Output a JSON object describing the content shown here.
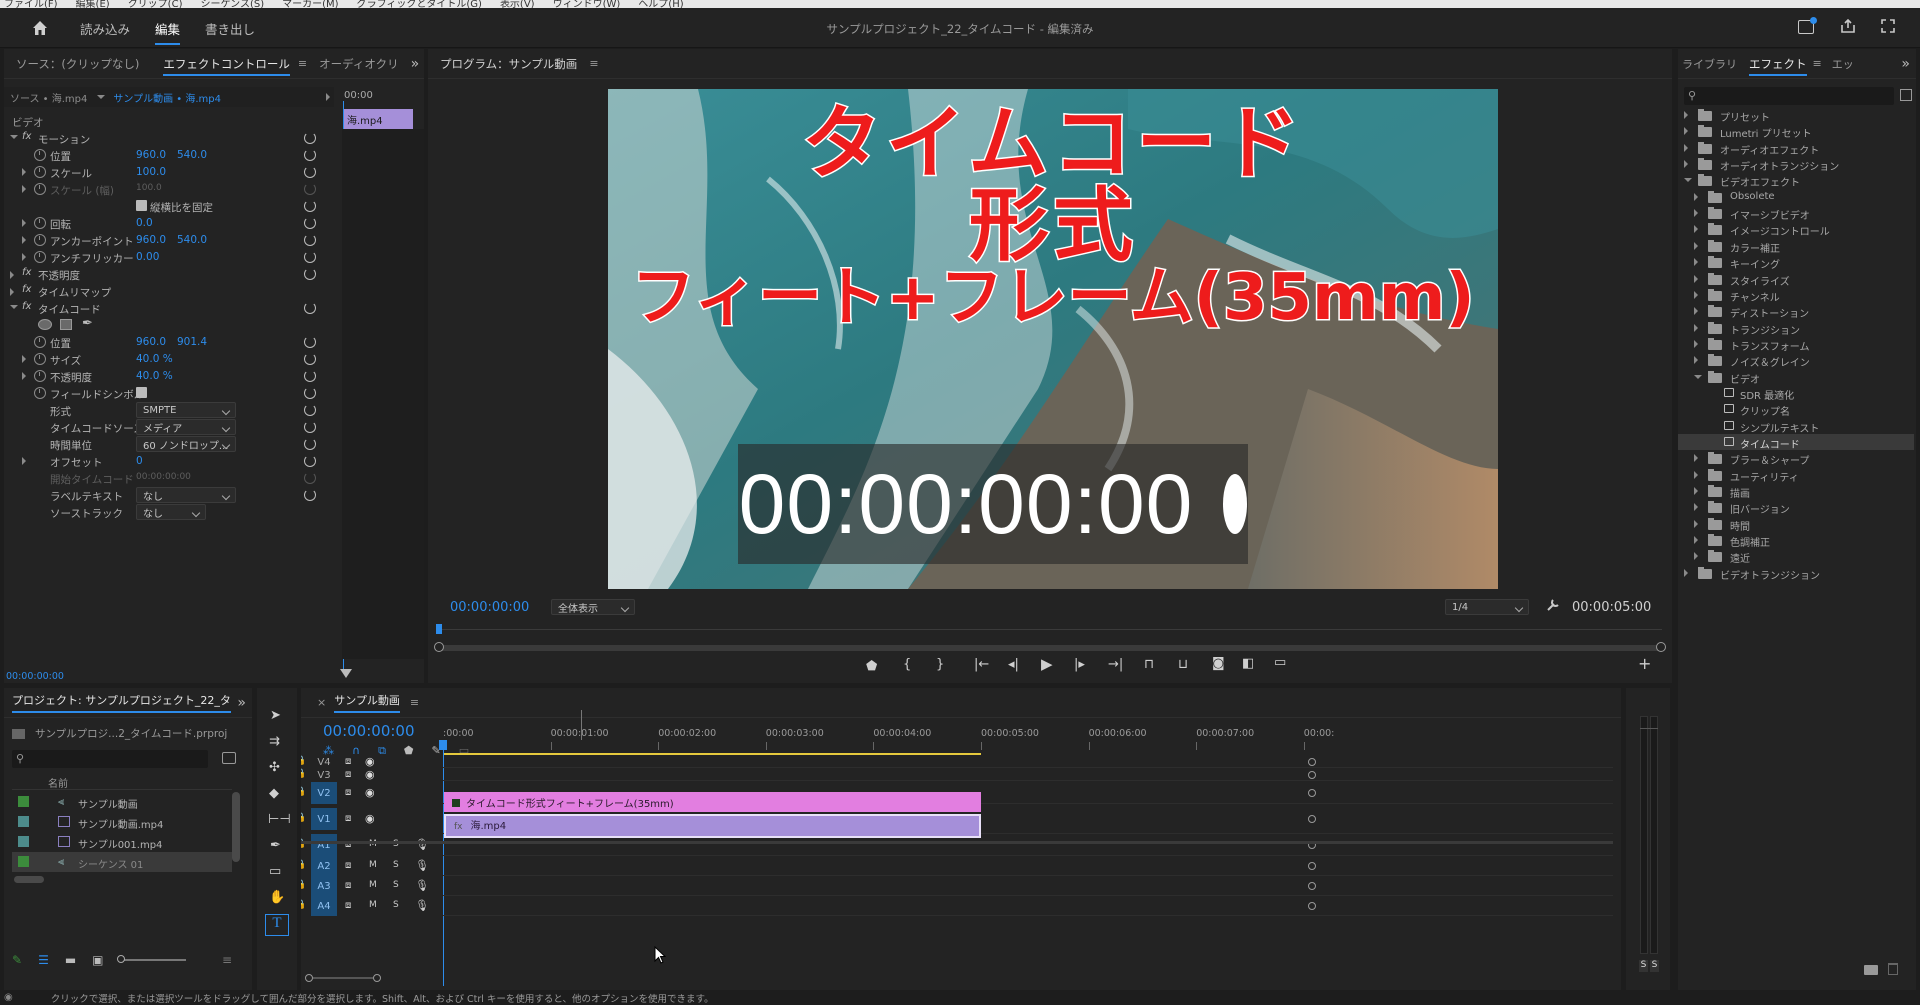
{
  "menubar": {
    "items": [
      "ファイル(F)",
      "編集(E)",
      "クリップ(C)",
      "シーケンス(S)",
      "マーカー(M)",
      "グラフィックとタイトル(G)",
      "表示(V)",
      "ウィンドウ(W)",
      "ヘルプ(H)"
    ]
  },
  "workspace": {
    "tabs": [
      "読み込み",
      "編集",
      "書き出し"
    ],
    "active": "編集",
    "title": "サンプルプロジェクト_22_タイムコード - 編集済み"
  },
  "effect_controls": {
    "tabs": [
      "ソース：(クリップなし)",
      "エフェクトコントロール",
      "オーディオクリ"
    ],
    "source": "ソース • 海.mp4",
    "sequence": "サンプル動画 • 海.mp4",
    "time_top": "00:00",
    "clip": "海.mp4",
    "section": "ビデオ",
    "motion": "モーション",
    "position": "位置",
    "pos_x": "960.0",
    "pos_y": "540.0",
    "scale": "スケール",
    "scale_v": "100.0",
    "scale_w": "スケール (幅)",
    "scale_w_v": "100.0",
    "uniform": "縦横比を固定",
    "rotation": "回転",
    "rotation_v": "0.0",
    "anchor": "アンカーポイント",
    "anchor_x": "960.0",
    "anchor_y": "540.0",
    "flicker": "アンチフリッカー",
    "flicker_v": "0.00",
    "opacity": "不透明度",
    "remap": "タイムリマップ",
    "timecode": "タイムコード",
    "tc_pos": "位置",
    "tc_pos_x": "960.0",
    "tc_pos_y": "901.4",
    "size": "サイズ",
    "size_v": "40.0 %",
    "tc_opacity": "不透明度",
    "tc_opacity_v": "40.0 %",
    "field": "フィールドシンボル",
    "format": "形式",
    "format_v": "SMPTE",
    "tc_source": "タイムコードソース",
    "tc_source_v": "メディア",
    "time_unit": "時間単位",
    "time_unit_v": "60 ノンドロップ...",
    "offset": "オフセット",
    "offset_v": "0",
    "start_tc": "開始タイムコード",
    "start_tc_v": "00:00:00:00",
    "label_text": "ラベルテキスト",
    "label_text_v": "なし",
    "source_track": "ソーストラック",
    "source_track_v": "なし",
    "bottom_time": "00:00:00:00"
  },
  "program": {
    "title": "プログラム：サンプル動画",
    "overlay_lines": [
      "タイムコード",
      "形式",
      "フィート+フレーム(35mm)"
    ],
    "timecode_display": "00:00:00:00",
    "current_time": "00:00:00:00",
    "fit": "全体表示",
    "quality": "1/4",
    "duration": "00:00:05:00"
  },
  "effects_panel": {
    "tabs": [
      "ライブラリ",
      "エフェクト",
      "エッ"
    ],
    "items": [
      {
        "label": "プリセット",
        "level": 0,
        "type": "folder",
        "open": false
      },
      {
        "label": "Lumetri プリセット",
        "level": 0,
        "type": "folder",
        "open": false
      },
      {
        "label": "オーディオエフェクト",
        "level": 0,
        "type": "folder",
        "open": false
      },
      {
        "label": "オーディオトランジション",
        "level": 0,
        "type": "folder",
        "open": false
      },
      {
        "label": "ビデオエフェクト",
        "level": 0,
        "type": "folder",
        "open": true
      },
      {
        "label": "Obsolete",
        "level": 1,
        "type": "folder",
        "open": false
      },
      {
        "label": "イマーシブビデオ",
        "level": 1,
        "type": "folder",
        "open": false
      },
      {
        "label": "イメージコントロール",
        "level": 1,
        "type": "folder",
        "open": false
      },
      {
        "label": "カラー補正",
        "level": 1,
        "type": "folder",
        "open": false
      },
      {
        "label": "キーイング",
        "level": 1,
        "type": "folder",
        "open": false
      },
      {
        "label": "スタイライズ",
        "level": 1,
        "type": "folder",
        "open": false
      },
      {
        "label": "チャンネル",
        "level": 1,
        "type": "folder",
        "open": false
      },
      {
        "label": "ディストーション",
        "level": 1,
        "type": "folder",
        "open": false
      },
      {
        "label": "トランジション",
        "level": 1,
        "type": "folder",
        "open": false
      },
      {
        "label": "トランスフォーム",
        "level": 1,
        "type": "folder",
        "open": false
      },
      {
        "label": "ノイズ＆グレイン",
        "level": 1,
        "type": "folder",
        "open": false
      },
      {
        "label": "ビデオ",
        "level": 1,
        "type": "folder",
        "open": true
      },
      {
        "label": "SDR 最適化",
        "level": 2,
        "type": "effect",
        "open": false
      },
      {
        "label": "クリップ名",
        "level": 2,
        "type": "effect",
        "open": false
      },
      {
        "label": "シンプルテキスト",
        "level": 2,
        "type": "effect",
        "open": false
      },
      {
        "label": "タイムコード",
        "level": 2,
        "type": "effect",
        "open": false,
        "selected": true
      },
      {
        "label": "ブラー＆シャープ",
        "level": 1,
        "type": "folder",
        "open": false
      },
      {
        "label": "ユーティリティ",
        "level": 1,
        "type": "folder",
        "open": false
      },
      {
        "label": "描画",
        "level": 1,
        "type": "folder",
        "open": false
      },
      {
        "label": "旧バージョン",
        "level": 1,
        "type": "folder",
        "open": false
      },
      {
        "label": "時間",
        "level": 1,
        "type": "folder",
        "open": false
      },
      {
        "label": "色調補正",
        "level": 1,
        "type": "folder",
        "open": false
      },
      {
        "label": "遠近",
        "level": 1,
        "type": "folder",
        "open": false
      },
      {
        "label": "ビデオトランジション",
        "level": 0,
        "type": "folder",
        "open": false
      }
    ]
  },
  "project": {
    "title": "プロジェクト: サンプルプロジェクト_22_タ",
    "file": "サンプルプロジ...2_タイムコード.prproj",
    "col_name": "名前",
    "items": [
      {
        "label": "サンプル動画",
        "color": "#3c8c3c",
        "kind": "seq"
      },
      {
        "label": "サンプル動画.mp4",
        "color": "#4d8c8c",
        "kind": "clip"
      },
      {
        "label": "サンプル001.mp4",
        "color": "#4d8c8c",
        "kind": "clip"
      },
      {
        "label": "シーケンス 01",
        "color": "#3c8c3c",
        "kind": "seq",
        "selected": true
      }
    ]
  },
  "timeline": {
    "tab": "サンプル動画",
    "timecode": "00:00:00:00",
    "ruler": [
      ":00:00",
      "00:00:01:00",
      "00:00:02:00",
      "00:00:03:00",
      "00:00:04:00",
      "00:00:05:00",
      "00:00:06:00",
      "00:00:07:00",
      "00:00:"
    ],
    "video_tracks": [
      "V4",
      "V3",
      "V2",
      "V1"
    ],
    "audio_tracks": [
      "A1",
      "A2",
      "A3",
      "A4"
    ],
    "src_v": "V1",
    "src_a": "A1",
    "clip_v2": "タイムコード形式フィート+フレーム(35mm)",
    "clip_v1": "海.mp4",
    "clip_fx": "fx"
  },
  "meters": {
    "labels": [
      "S",
      "S"
    ]
  },
  "status": "クリックで選択、または選択ツールをドラッグして囲んだ部分を選択します。Shift、Alt、および Ctrl キーを使用すると、他のオプションを使用できます。",
  "colors": {
    "accent": "#2d8ceb",
    "clip_v2": "#e27ee0",
    "clip_v1": "#a58fd9",
    "overlay_text": "#ee1c1c"
  }
}
